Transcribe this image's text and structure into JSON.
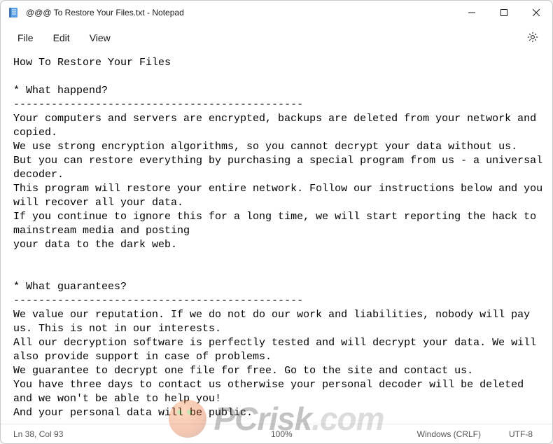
{
  "window": {
    "title": "@@@ To Restore Your Files.txt - Notepad"
  },
  "menu": {
    "file": "File",
    "edit": "Edit",
    "view": "View"
  },
  "document": {
    "text": "How To Restore Your Files\n\n* What happend?\n----------------------------------------------\nYour computers and servers are encrypted, backups are deleted from your network and copied.\nWe use strong encryption algorithms, so you cannot decrypt your data without us.\nBut you can restore everything by purchasing a special program from us - a universal decoder.\nThis program will restore your entire network. Follow our instructions below and you will recover all your data.\nIf you continue to ignore this for a long time, we will start reporting the hack to mainstream media and posting\nyour data to the dark web.\n\n\n* What guarantees?\n----------------------------------------------\nWe value our reputation. If we do not do our work and liabilities, nobody will pay us. This is not in our interests.\nAll our decryption software is perfectly tested and will decrypt your data. We will also provide support in case of problems.\nWe guarantee to decrypt one file for free. Go to the site and contact us.\nYou have three days to contact us otherwise your personal decoder will be deleted and we won't be able to help you!\nAnd your personal data will be public.\n"
  },
  "status": {
    "cursor": "Ln 38, Col 93",
    "zoom": "100%",
    "line_ending": "Windows (CRLF)",
    "encoding": "UTF-8"
  },
  "watermark": {
    "text_main": "PCrisk",
    "text_suffix": ".com"
  }
}
